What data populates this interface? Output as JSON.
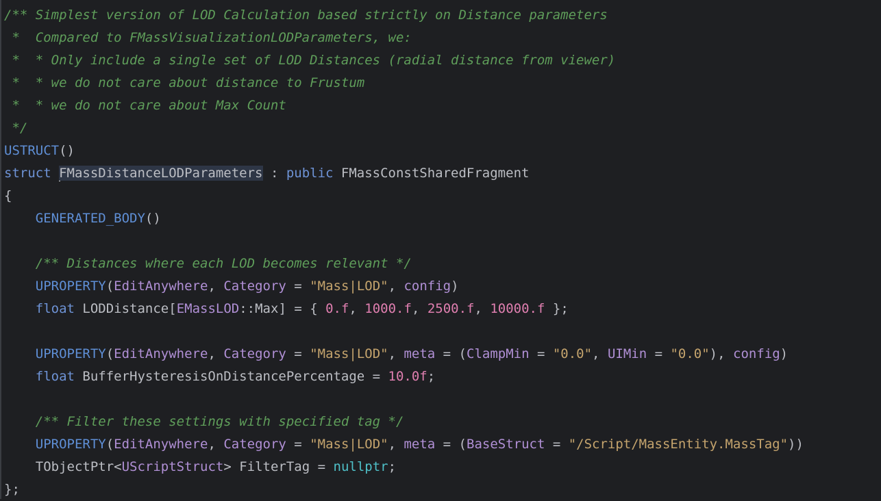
{
  "editor": {
    "lines": [
      {
        "indent": 0,
        "tokens": [
          {
            "t": "/** Simplest version of LOD Calculation based strictly on Distance parameters",
            "c": "comment"
          }
        ]
      },
      {
        "indent": 0,
        "tokens": [
          {
            "t": " *  Compared to FMassVisualizationLODParameters, we:",
            "c": "comment"
          }
        ]
      },
      {
        "indent": 0,
        "tokens": [
          {
            "t": " *  * Only include a single set of LOD Distances (radial distance from viewer)",
            "c": "comment"
          }
        ]
      },
      {
        "indent": 0,
        "tokens": [
          {
            "t": " *  * we do not care about distance to Frustum",
            "c": "comment"
          }
        ]
      },
      {
        "indent": 0,
        "tokens": [
          {
            "t": " *  * we do not care about Max Count",
            "c": "comment"
          }
        ]
      },
      {
        "indent": 0,
        "tokens": [
          {
            "t": " */",
            "c": "comment"
          }
        ]
      },
      {
        "indent": 0,
        "tokens": [
          {
            "t": "USTRUCT",
            "c": "macro"
          },
          {
            "t": "()",
            "c": "punct"
          }
        ]
      },
      {
        "indent": 0,
        "tokens": [
          {
            "t": "struct ",
            "c": "kw"
          },
          {
            "t": "FMassDistanceLODParameters",
            "c": "ident",
            "hl": true,
            "cursor": true
          },
          {
            "t": " : ",
            "c": "punct"
          },
          {
            "t": "public ",
            "c": "kw"
          },
          {
            "t": "FMassConstSharedFragment",
            "c": "type"
          }
        ]
      },
      {
        "indent": 0,
        "tokens": [
          {
            "t": "{",
            "c": "punct"
          }
        ]
      },
      {
        "indent": 1,
        "tokens": [
          {
            "t": "GENERATED_BODY",
            "c": "macro"
          },
          {
            "t": "()",
            "c": "punct"
          }
        ]
      },
      {
        "indent": 0,
        "tokens": []
      },
      {
        "indent": 1,
        "tokens": [
          {
            "t": "/** Distances where each LOD becomes relevant */",
            "c": "comment"
          }
        ]
      },
      {
        "indent": 1,
        "tokens": [
          {
            "t": "UPROPERTY",
            "c": "macro"
          },
          {
            "t": "(",
            "c": "punct"
          },
          {
            "t": "EditAnywhere",
            "c": "param"
          },
          {
            "t": ", ",
            "c": "punct"
          },
          {
            "t": "Category",
            "c": "param"
          },
          {
            "t": " = ",
            "c": "punct"
          },
          {
            "t": "\"Mass|LOD\"",
            "c": "str"
          },
          {
            "t": ", ",
            "c": "punct"
          },
          {
            "t": "config",
            "c": "param"
          },
          {
            "t": ")",
            "c": "punct"
          }
        ]
      },
      {
        "indent": 1,
        "tokens": [
          {
            "t": "float ",
            "c": "kw"
          },
          {
            "t": "LODDistance",
            "c": "ident"
          },
          {
            "t": "[",
            "c": "punct"
          },
          {
            "t": "EMassLOD",
            "c": "param"
          },
          {
            "t": "::",
            "c": "punct"
          },
          {
            "t": "Max",
            "c": "ident"
          },
          {
            "t": "] = { ",
            "c": "punct"
          },
          {
            "t": "0.f",
            "c": "num"
          },
          {
            "t": ", ",
            "c": "punct"
          },
          {
            "t": "1000.f",
            "c": "num"
          },
          {
            "t": ", ",
            "c": "punct"
          },
          {
            "t": "2500.f",
            "c": "num"
          },
          {
            "t": ", ",
            "c": "punct"
          },
          {
            "t": "10000.f",
            "c": "num"
          },
          {
            "t": " };",
            "c": "punct"
          }
        ]
      },
      {
        "indent": 0,
        "tokens": []
      },
      {
        "indent": 1,
        "tokens": [
          {
            "t": "UPROPERTY",
            "c": "macro"
          },
          {
            "t": "(",
            "c": "punct"
          },
          {
            "t": "EditAnywhere",
            "c": "param"
          },
          {
            "t": ", ",
            "c": "punct"
          },
          {
            "t": "Category",
            "c": "param"
          },
          {
            "t": " = ",
            "c": "punct"
          },
          {
            "t": "\"Mass|LOD\"",
            "c": "str"
          },
          {
            "t": ", ",
            "c": "punct"
          },
          {
            "t": "meta",
            "c": "param"
          },
          {
            "t": " = (",
            "c": "punct"
          },
          {
            "t": "ClampMin",
            "c": "param"
          },
          {
            "t": " = ",
            "c": "punct"
          },
          {
            "t": "\"0.0\"",
            "c": "str"
          },
          {
            "t": ", ",
            "c": "punct"
          },
          {
            "t": "UIMin",
            "c": "param"
          },
          {
            "t": " = ",
            "c": "punct"
          },
          {
            "t": "\"0.0\"",
            "c": "str"
          },
          {
            "t": "), ",
            "c": "punct"
          },
          {
            "t": "config",
            "c": "param"
          },
          {
            "t": ")",
            "c": "punct"
          }
        ]
      },
      {
        "indent": 1,
        "tokens": [
          {
            "t": "float ",
            "c": "kw"
          },
          {
            "t": "BufferHysteresisOnDistancePercentage",
            "c": "ident"
          },
          {
            "t": " = ",
            "c": "punct"
          },
          {
            "t": "10.0f",
            "c": "num"
          },
          {
            "t": ";",
            "c": "punct"
          }
        ]
      },
      {
        "indent": 0,
        "tokens": []
      },
      {
        "indent": 1,
        "tokens": [
          {
            "t": "/** Filter these settings with specified tag */",
            "c": "comment"
          }
        ]
      },
      {
        "indent": 1,
        "tokens": [
          {
            "t": "UPROPERTY",
            "c": "macro"
          },
          {
            "t": "(",
            "c": "punct"
          },
          {
            "t": "EditAnywhere",
            "c": "param"
          },
          {
            "t": ", ",
            "c": "punct"
          },
          {
            "t": "Category",
            "c": "param"
          },
          {
            "t": " = ",
            "c": "punct"
          },
          {
            "t": "\"Mass|LOD\"",
            "c": "str"
          },
          {
            "t": ", ",
            "c": "punct"
          },
          {
            "t": "meta",
            "c": "param"
          },
          {
            "t": " = (",
            "c": "punct"
          },
          {
            "t": "BaseStruct",
            "c": "param"
          },
          {
            "t": " = ",
            "c": "punct"
          },
          {
            "t": "\"/Script/MassEntity.MassTag\"",
            "c": "str"
          },
          {
            "t": "))",
            "c": "punct"
          }
        ]
      },
      {
        "indent": 1,
        "tokens": [
          {
            "t": "TObjectPtr",
            "c": "ident"
          },
          {
            "t": "<",
            "c": "punct"
          },
          {
            "t": "UScriptStruct",
            "c": "param"
          },
          {
            "t": "> ",
            "c": "punct"
          },
          {
            "t": "FilterTag",
            "c": "ident"
          },
          {
            "t": " = ",
            "c": "punct"
          },
          {
            "t": "nullptr",
            "c": "null"
          },
          {
            "t": ";",
            "c": "punct"
          }
        ]
      },
      {
        "indent": 0,
        "tokens": [
          {
            "t": "};",
            "c": "punct"
          }
        ]
      }
    ]
  }
}
